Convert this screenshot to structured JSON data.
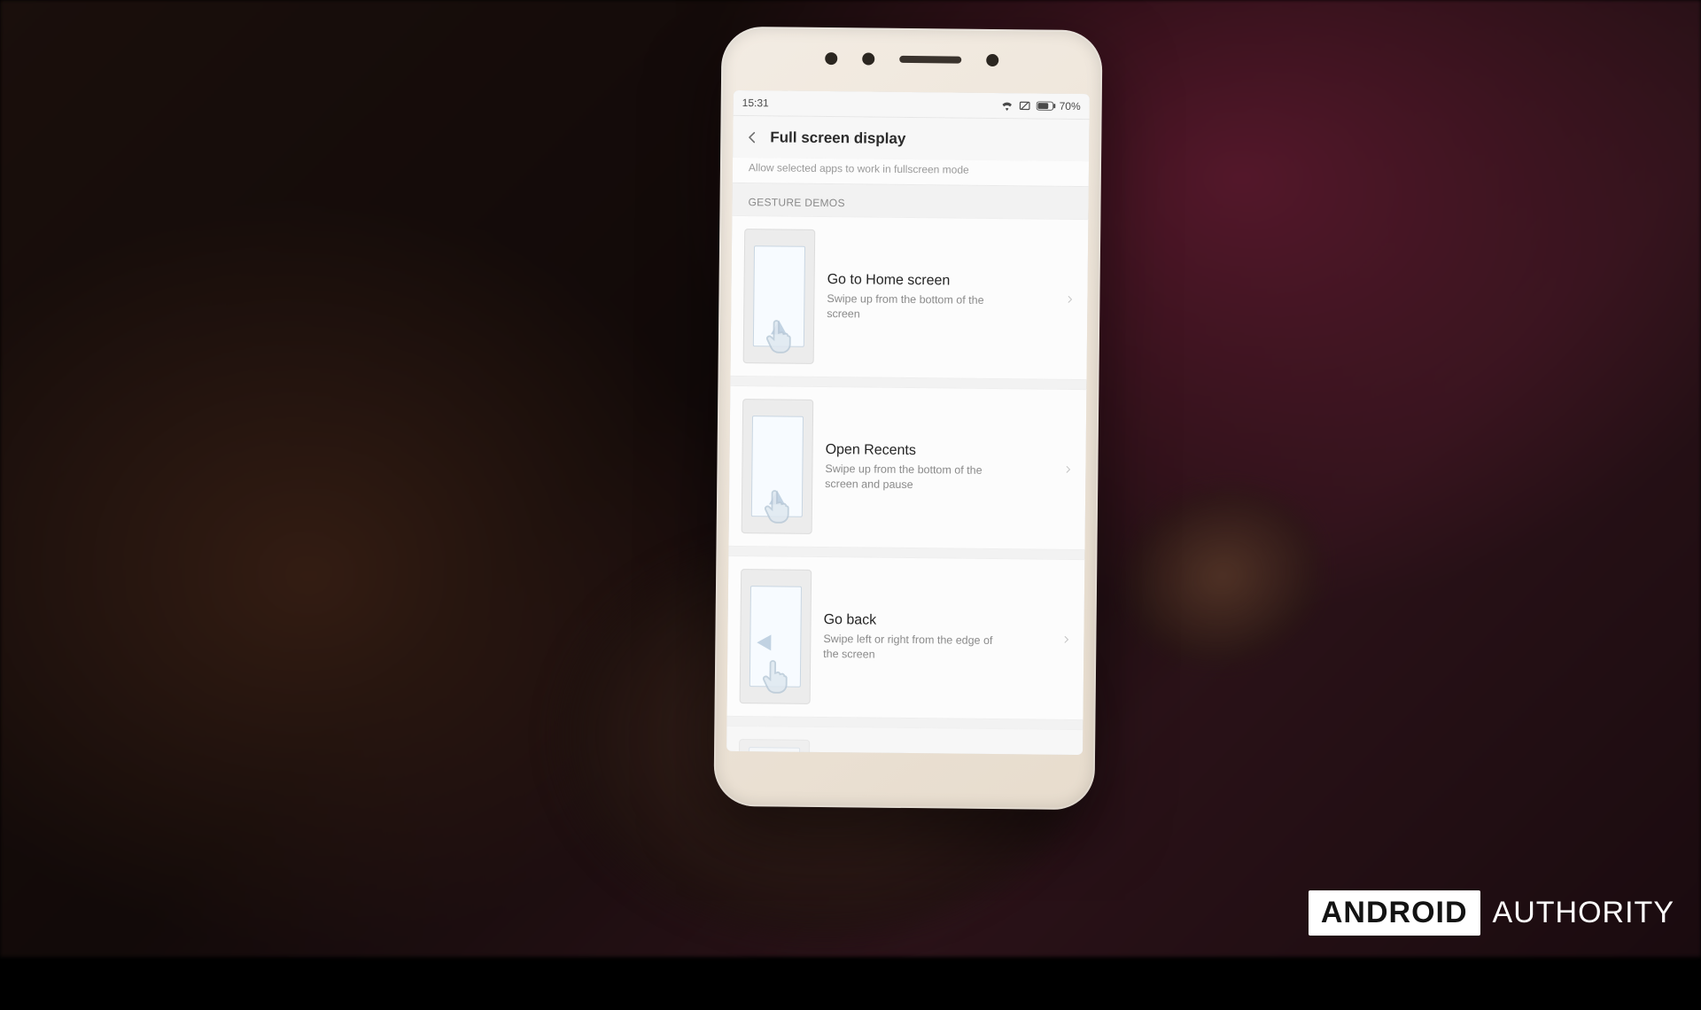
{
  "statusbar": {
    "time": "15:31",
    "battery_pct": "70%"
  },
  "header": {
    "title": "Full screen display"
  },
  "clipped_prev_row": "Allow selected apps to work in fullscreen mode",
  "section_header": "GESTURE DEMOS",
  "gestures": [
    {
      "title": "Go to Home screen",
      "sub": "Swipe up from the bottom of the screen"
    },
    {
      "title": "Open Recents",
      "sub": "Swipe up from the bottom of the screen and pause"
    },
    {
      "title": "Go back",
      "sub": "Swipe left or right from the edge of the screen"
    }
  ],
  "watermark": {
    "boxed": "ANDROID",
    "loose": "AUTHORITY"
  }
}
